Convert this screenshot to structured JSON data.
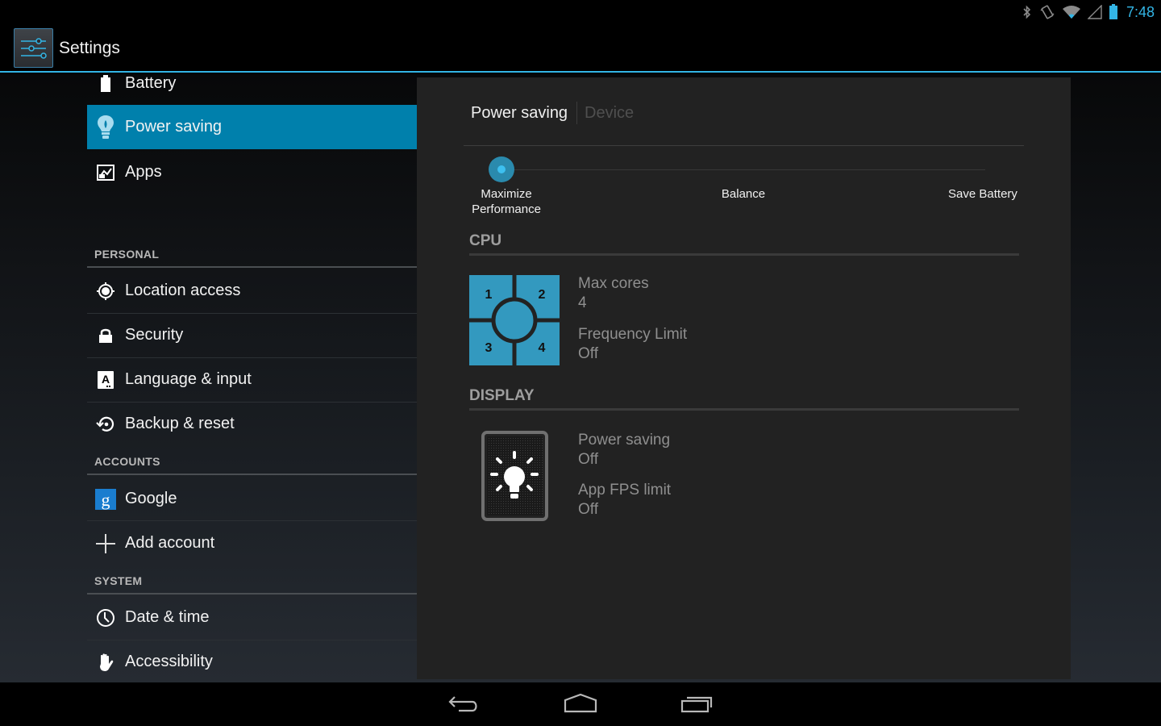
{
  "statusbar": {
    "icons": [
      "bluetooth-icon",
      "vibrate-icon",
      "wifi-icon",
      "cell-signal-icon",
      "battery-icon"
    ],
    "time": "7:48"
  },
  "actionbar": {
    "app_icon": "settings-sliders-icon",
    "title": "Settings"
  },
  "sidebar": {
    "items_top": [
      {
        "label": "Battery",
        "icon": "battery-icon"
      },
      {
        "label": "Power saving",
        "icon": "lightbulb-icon",
        "selected": true
      },
      {
        "label": "Apps",
        "icon": "apps-icon"
      }
    ],
    "sections": [
      {
        "title": "PERSONAL",
        "items": [
          {
            "label": "Location access",
            "icon": "location-icon"
          },
          {
            "label": "Security",
            "icon": "lock-icon"
          },
          {
            "label": "Language & input",
            "icon": "language-icon"
          },
          {
            "label": "Backup & reset",
            "icon": "backup-icon"
          }
        ]
      },
      {
        "title": "ACCOUNTS",
        "items": [
          {
            "label": "Google",
            "icon": "google-icon"
          },
          {
            "label": "Add account",
            "icon": "plus-icon"
          }
        ]
      },
      {
        "title": "SYSTEM",
        "items": [
          {
            "label": "Date & time",
            "icon": "clock-icon"
          },
          {
            "label": "Accessibility",
            "icon": "hand-icon"
          }
        ]
      }
    ]
  },
  "detail": {
    "breadcrumb": {
      "active": "Power saving",
      "inactive": "Device"
    },
    "mode_slider": {
      "options": [
        "Maximize Performance",
        "Balance",
        "Save Battery"
      ],
      "selected_index": 0,
      "selected": "Maximize Performance"
    },
    "cpu": {
      "title": "CPU",
      "core_labels": [
        "1",
        "2",
        "3",
        "4"
      ],
      "max_cores_label": "Max cores",
      "max_cores_value": "4",
      "freq_label": "Frequency Limit",
      "freq_value": "Off"
    },
    "display": {
      "title": "DISPLAY",
      "power_saving_label": "Power saving",
      "power_saving_value": "Off",
      "fps_label": "App FPS limit",
      "fps_value": "Off"
    }
  },
  "navbar": {
    "back": "back-icon",
    "home": "home-icon",
    "recents": "recent-apps-icon"
  },
  "colors": {
    "accent": "#33b5e5",
    "selected_item": "#0080ac",
    "cpu_tile": "#3399bf"
  }
}
